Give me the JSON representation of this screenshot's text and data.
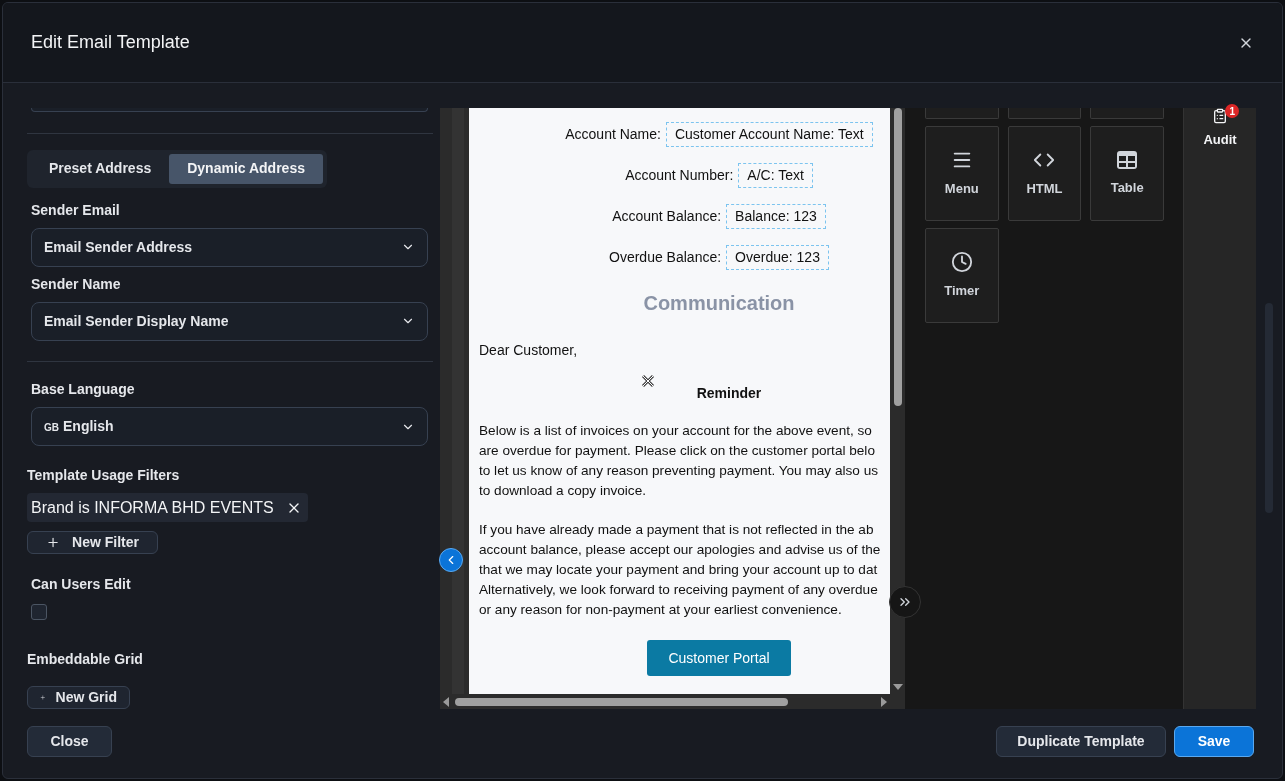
{
  "dialog": {
    "title": "Edit Email Template"
  },
  "address_tabs": [
    {
      "label": "Preset Address",
      "selected": false
    },
    {
      "label": "Dynamic Address",
      "selected": true
    }
  ],
  "sender_email": {
    "label": "Sender Email",
    "value": "Email Sender Address"
  },
  "sender_name": {
    "label": "Sender Name",
    "value": "Email Sender Display Name"
  },
  "base_language": {
    "label": "Base Language",
    "flag": "GB",
    "value": "English"
  },
  "usage_filters": {
    "label": "Template Usage Filters",
    "chips": [
      "Brand is INFORMA BHD EVENTS"
    ],
    "add_button": "New Filter"
  },
  "can_users_edit": {
    "label": "Can Users Edit",
    "checked": false
  },
  "embeddable_grid": {
    "label": "Embeddable Grid",
    "add_button": "New Grid"
  },
  "preview": {
    "fields": [
      {
        "label": "Account Name:",
        "token": "Customer Account Name: Text"
      },
      {
        "label": "Account Number:",
        "token": "A/C: Text"
      },
      {
        "label": "Account Balance:",
        "token": "Balance: 123"
      },
      {
        "label": "Overdue Balance:",
        "token": "Overdue: 123"
      }
    ],
    "heading": "Communication",
    "greeting": "Dear Customer,",
    "subheading": "Reminder",
    "paragraphs": [
      [
        "Below is a list of invoices on your account for the above event, so",
        "are overdue for payment. Please click on the customer portal belo",
        "to let us know of any reason preventing payment. You may also us",
        "to download a copy invoice."
      ],
      [
        "If you have already made a payment that is not reflected in the ab",
        "account balance, please accept our apologies and advise us of the",
        "that we may locate your payment and bring your account up to dat",
        "Alternatively, we look forward to receiving payment of any overdue",
        "or any reason for non-payment at your earliest convenience."
      ]
    ],
    "button": "Customer Portal"
  },
  "blocks": [
    {
      "kind": "menu",
      "label": "Menu"
    },
    {
      "kind": "html",
      "label": "HTML"
    },
    {
      "kind": "table",
      "label": "Table"
    },
    {
      "kind": "timer",
      "label": "Timer"
    }
  ],
  "audit": {
    "label": "Audit",
    "badge": "1"
  },
  "footer": {
    "close": "Close",
    "duplicate": "Duplicate Template",
    "save": "Save"
  }
}
